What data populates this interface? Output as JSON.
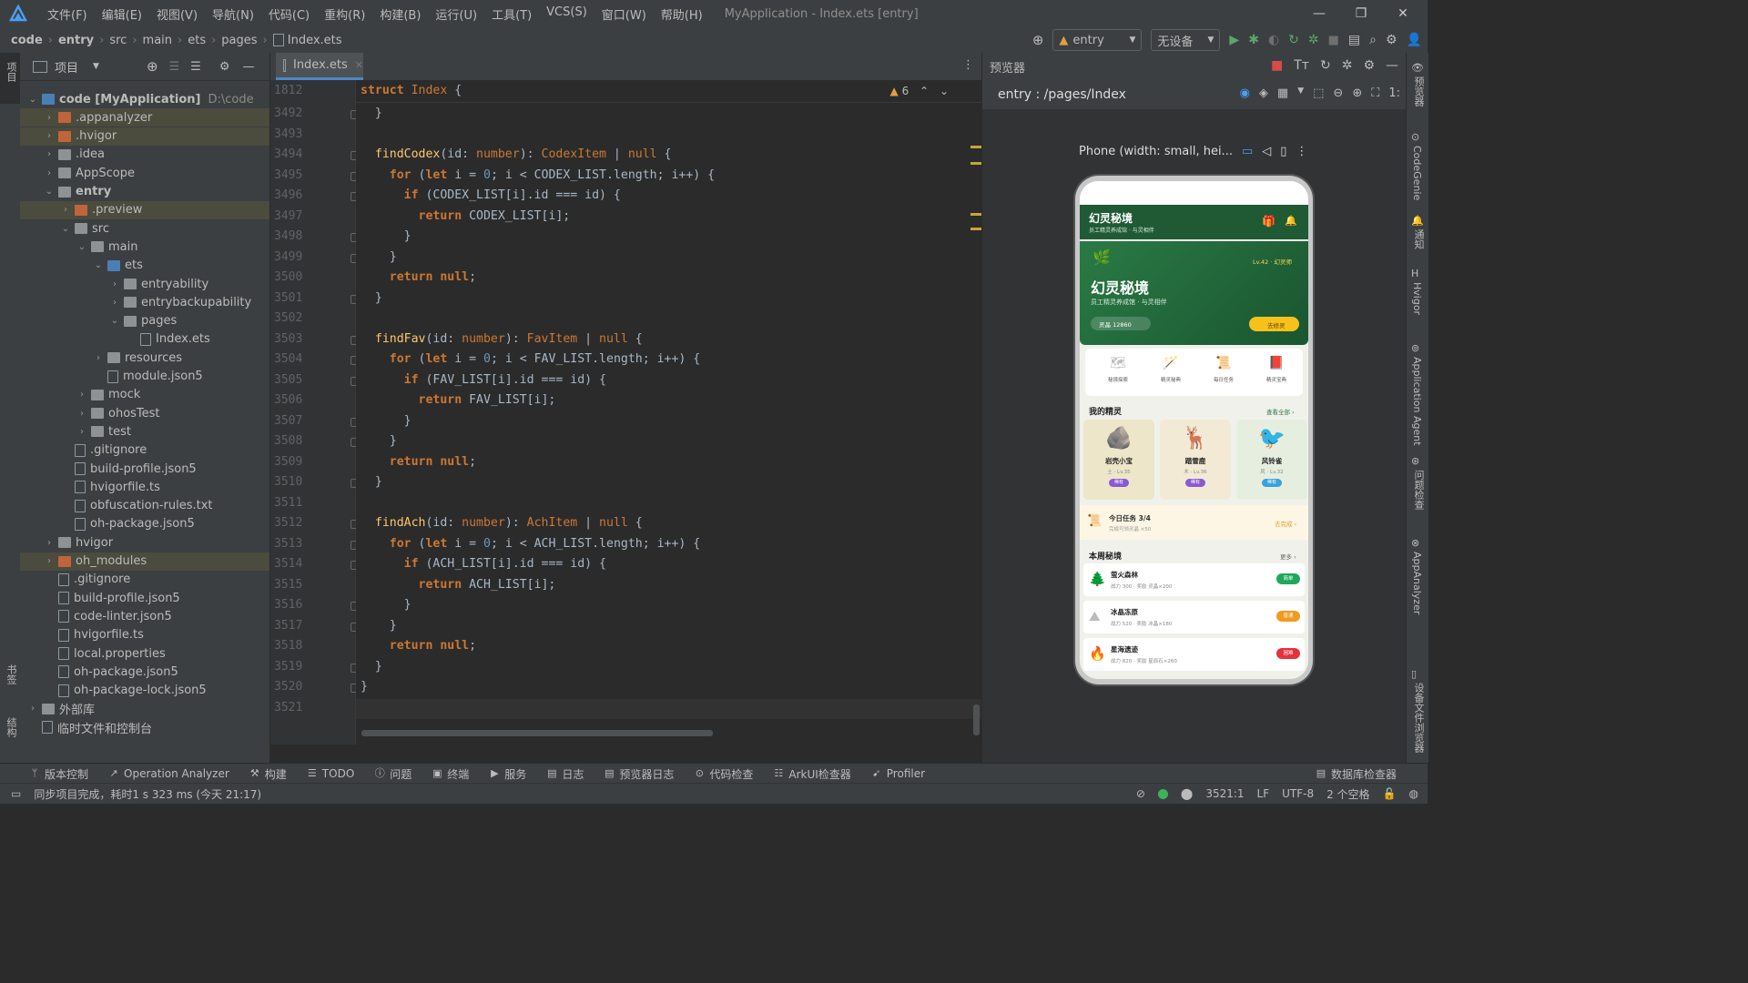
{
  "titlebar": {
    "menu": [
      "文件(F)",
      "编辑(E)",
      "视图(V)",
      "导航(N)",
      "代码(C)",
      "重构(R)",
      "构建(B)",
      "运行(U)",
      "工具(T)",
      "VCS(S)",
      "窗口(W)",
      "帮助(H)"
    ],
    "window_title": "MyApplication - Index.ets [entry]"
  },
  "breadcrumb": [
    "code",
    "entry",
    "src",
    "main",
    "ets",
    "pages",
    "Index.ets"
  ],
  "toolbar_right": {
    "module": "entry",
    "device": "无设备"
  },
  "left_strip": {
    "top_label": "项目",
    "bottom1": "书签",
    "bottom2": "结构"
  },
  "project": {
    "title": "项目",
    "items": [
      {
        "name": "code [MyApplication]",
        "extra": "D:\\code",
        "level": 0,
        "arrow": "open",
        "kind": "folder-bl",
        "sel": false,
        "bold": true
      },
      {
        "name": ".appanalyzer",
        "level": 1,
        "arrow": "closed",
        "kind": "folder-or",
        "sel": true
      },
      {
        "name": ".hvigor",
        "level": 1,
        "arrow": "closed",
        "kind": "folder-or",
        "sel": true
      },
      {
        "name": ".idea",
        "level": 1,
        "arrow": "closed",
        "kind": "folder",
        "sel": false
      },
      {
        "name": "AppScope",
        "level": 1,
        "arrow": "closed",
        "kind": "folder",
        "sel": false
      },
      {
        "name": "entry",
        "level": 1,
        "arrow": "open",
        "kind": "folder",
        "sel": false,
        "bold": true
      },
      {
        "name": ".preview",
        "level": 2,
        "arrow": "closed",
        "kind": "folder-or",
        "sel": true
      },
      {
        "name": "src",
        "level": 2,
        "arrow": "open",
        "kind": "folder",
        "sel": false
      },
      {
        "name": "main",
        "level": 3,
        "arrow": "open",
        "kind": "folder",
        "sel": false
      },
      {
        "name": "ets",
        "level": 4,
        "arrow": "open",
        "kind": "folder-bl",
        "sel": false
      },
      {
        "name": "entryability",
        "level": 5,
        "arrow": "closed",
        "kind": "folder",
        "sel": false
      },
      {
        "name": "entrybackupability",
        "level": 5,
        "arrow": "closed",
        "kind": "folder",
        "sel": false
      },
      {
        "name": "pages",
        "level": 5,
        "arrow": "open",
        "kind": "folder",
        "sel": false
      },
      {
        "name": "Index.ets",
        "level": 6,
        "arrow": "none",
        "kind": "file",
        "sel": false
      },
      {
        "name": "resources",
        "level": 4,
        "arrow": "closed",
        "kind": "folder",
        "sel": false
      },
      {
        "name": "module.json5",
        "level": 4,
        "arrow": "none",
        "kind": "file",
        "sel": false
      },
      {
        "name": "mock",
        "level": 3,
        "arrow": "closed",
        "kind": "folder",
        "sel": false
      },
      {
        "name": "ohosTest",
        "level": 3,
        "arrow": "closed",
        "kind": "folder",
        "sel": false
      },
      {
        "name": "test",
        "level": 3,
        "arrow": "closed",
        "kind": "folder",
        "sel": false
      },
      {
        "name": ".gitignore",
        "level": 2,
        "arrow": "none",
        "kind": "file",
        "sel": false
      },
      {
        "name": "build-profile.json5",
        "level": 2,
        "arrow": "none",
        "kind": "file",
        "sel": false
      },
      {
        "name": "hvigorfile.ts",
        "level": 2,
        "arrow": "none",
        "kind": "file",
        "sel": false
      },
      {
        "name": "obfuscation-rules.txt",
        "level": 2,
        "arrow": "none",
        "kind": "file",
        "sel": false
      },
      {
        "name": "oh-package.json5",
        "level": 2,
        "arrow": "none",
        "kind": "file",
        "sel": false
      },
      {
        "name": "hvigor",
        "level": 1,
        "arrow": "closed",
        "kind": "folder",
        "sel": false
      },
      {
        "name": "oh_modules",
        "level": 1,
        "arrow": "closed",
        "kind": "folder-or",
        "sel": true
      },
      {
        "name": ".gitignore",
        "level": 1,
        "arrow": "none",
        "kind": "file",
        "sel": false
      },
      {
        "name": "build-profile.json5",
        "level": 1,
        "arrow": "none",
        "kind": "file",
        "sel": false
      },
      {
        "name": "code-linter.json5",
        "level": 1,
        "arrow": "none",
        "kind": "file",
        "sel": false
      },
      {
        "name": "hvigorfile.ts",
        "level": 1,
        "arrow": "none",
        "kind": "file",
        "sel": false
      },
      {
        "name": "local.properties",
        "level": 1,
        "arrow": "none",
        "kind": "file",
        "sel": false
      },
      {
        "name": "oh-package.json5",
        "level": 1,
        "arrow": "none",
        "kind": "file",
        "sel": false
      },
      {
        "name": "oh-package-lock.json5",
        "level": 1,
        "arrow": "none",
        "kind": "file",
        "sel": false
      },
      {
        "name": "外部库",
        "level": 0,
        "arrow": "closed",
        "kind": "lib",
        "sel": false
      },
      {
        "name": "临时文件和控制台",
        "level": 0,
        "arrow": "none",
        "kind": "scratch",
        "sel": false
      }
    ]
  },
  "editor": {
    "tab": "Index.ets",
    "warning_count": "6",
    "sticky": {
      "line": "1812",
      "text": [
        [
          "kw",
          "struct "
        ],
        [
          "ty",
          "Index "
        ],
        [
          "id",
          "{"
        ]
      ]
    },
    "lines": [
      {
        "n": "3492",
        "t": [
          [
            "id",
            "  }"
          ]
        ]
      },
      {
        "n": "3493",
        "t": []
      },
      {
        "n": "3494",
        "t": [
          [
            "fn",
            "  findCodex"
          ],
          [
            "id",
            "(id: "
          ],
          [
            "ty",
            "number"
          ],
          [
            "id",
            "): "
          ],
          [
            "ty",
            "CodexItem"
          ],
          [
            "id",
            " | "
          ],
          [
            "ty",
            "null"
          ],
          [
            "id",
            " {"
          ]
        ]
      },
      {
        "n": "3495",
        "t": [
          [
            "kw",
            "    for "
          ],
          [
            "id",
            "("
          ],
          [
            "kw",
            "let "
          ],
          [
            "id",
            "i = "
          ],
          [
            "nm",
            "0"
          ],
          [
            "id",
            "; i < CODEX_LIST.length; i++) {"
          ]
        ]
      },
      {
        "n": "3496",
        "t": [
          [
            "kw",
            "      if "
          ],
          [
            "id",
            "(CODEX_LIST[i].id === id) {"
          ]
        ]
      },
      {
        "n": "3497",
        "t": [
          [
            "kw",
            "        return "
          ],
          [
            "id",
            "CODEX_LIST[i];"
          ]
        ]
      },
      {
        "n": "3498",
        "t": [
          [
            "id",
            "      }"
          ]
        ]
      },
      {
        "n": "3499",
        "t": [
          [
            "id",
            "    }"
          ]
        ]
      },
      {
        "n": "3500",
        "t": [
          [
            "kw",
            "    return null"
          ],
          [
            "id",
            ";"
          ]
        ]
      },
      {
        "n": "3501",
        "t": [
          [
            "id",
            "  }"
          ]
        ]
      },
      {
        "n": "3502",
        "t": []
      },
      {
        "n": "3503",
        "t": [
          [
            "fn",
            "  findFav"
          ],
          [
            "id",
            "(id: "
          ],
          [
            "ty",
            "number"
          ],
          [
            "id",
            "): "
          ],
          [
            "ty",
            "FavItem"
          ],
          [
            "id",
            " | "
          ],
          [
            "ty",
            "null"
          ],
          [
            "id",
            " {"
          ]
        ]
      },
      {
        "n": "3504",
        "t": [
          [
            "kw",
            "    for "
          ],
          [
            "id",
            "("
          ],
          [
            "kw",
            "let "
          ],
          [
            "id",
            "i = "
          ],
          [
            "nm",
            "0"
          ],
          [
            "id",
            "; i < FAV_LIST.length; i++) {"
          ]
        ]
      },
      {
        "n": "3505",
        "t": [
          [
            "kw",
            "      if "
          ],
          [
            "id",
            "(FAV_LIST[i].id === id) {"
          ]
        ]
      },
      {
        "n": "3506",
        "t": [
          [
            "kw",
            "        return "
          ],
          [
            "id",
            "FAV_LIST[i];"
          ]
        ]
      },
      {
        "n": "3507",
        "t": [
          [
            "id",
            "      }"
          ]
        ]
      },
      {
        "n": "3508",
        "t": [
          [
            "id",
            "    }"
          ]
        ]
      },
      {
        "n": "3509",
        "t": [
          [
            "kw",
            "    return null"
          ],
          [
            "id",
            ";"
          ]
        ]
      },
      {
        "n": "3510",
        "t": [
          [
            "id",
            "  }"
          ]
        ]
      },
      {
        "n": "3511",
        "t": []
      },
      {
        "n": "3512",
        "t": [
          [
            "fn",
            "  findAch"
          ],
          [
            "id",
            "(id: "
          ],
          [
            "ty",
            "number"
          ],
          [
            "id",
            "): "
          ],
          [
            "ty",
            "AchItem"
          ],
          [
            "id",
            " | "
          ],
          [
            "ty",
            "null"
          ],
          [
            "id",
            " {"
          ]
        ]
      },
      {
        "n": "3513",
        "t": [
          [
            "kw",
            "    for "
          ],
          [
            "id",
            "("
          ],
          [
            "kw",
            "let "
          ],
          [
            "id",
            "i = "
          ],
          [
            "nm",
            "0"
          ],
          [
            "id",
            "; i < ACH_LIST.length; i++) {"
          ]
        ]
      },
      {
        "n": "3514",
        "t": [
          [
            "kw",
            "      if "
          ],
          [
            "id",
            "(ACH_LIST[i].id === id) {"
          ]
        ]
      },
      {
        "n": "3515",
        "t": [
          [
            "kw",
            "        return "
          ],
          [
            "id",
            "ACH_LIST[i];"
          ]
        ]
      },
      {
        "n": "3516",
        "t": [
          [
            "id",
            "      }"
          ]
        ]
      },
      {
        "n": "3517",
        "t": [
          [
            "id",
            "    }"
          ]
        ]
      },
      {
        "n": "3518",
        "t": [
          [
            "kw",
            "    return null"
          ],
          [
            "id",
            ";"
          ]
        ]
      },
      {
        "n": "3519",
        "t": [
          [
            "id",
            "  }"
          ]
        ]
      },
      {
        "n": "3520",
        "t": [
          [
            "id",
            "}"
          ]
        ]
      },
      {
        "n": "3521",
        "t": []
      }
    ]
  },
  "previewer": {
    "title": "预览器",
    "route": "entry : /pages/Index",
    "device_label": "Phone (width: small, hei...",
    "app": {
      "header_title": "幻灵秘境",
      "header_sub": "员工精灵养成馆 · 与灵相伴",
      "hero_level": "Lv.42 · 幻灵师",
      "hero_title": "幻灵秘境",
      "hero_sub": "员工精灵养成馆 · 与灵相伴",
      "hero_coins": "灵晶 12860",
      "hero_button": "去修灵",
      "quick": [
        "秘境探索",
        "精灵秘典",
        "每日任务",
        "精灵宝典"
      ],
      "my_sprites_title": "我的精灵",
      "my_sprites_more": "查看全部 ›",
      "sprites": [
        {
          "name": "岩壳小宝",
          "meta": "土 · Lv.35",
          "tag": "稀有"
        },
        {
          "name": "踏雪鹿",
          "meta": "木 · Lv.36",
          "tag": "稀有"
        },
        {
          "name": "风铃雀",
          "meta": "风 · Lv.32",
          "tag": "稀有"
        }
      ],
      "task_title": "今日任务 3/4",
      "task_sub": "完成可领灵晶 ×50",
      "task_action": "去完成 ›",
      "weekly_title": "本周秘境",
      "weekly_more": "更多 ›",
      "realms": [
        {
          "name": "萤火森林",
          "meta": "战力 300 · 奖励 灵晶×200",
          "badge": "简单",
          "color": "#1fa85a"
        },
        {
          "name": "冰晶冻原",
          "meta": "战力 520 · 奖励 冰晶×180",
          "badge": "普通",
          "color": "#f29a1f"
        },
        {
          "name": "星海遗迹",
          "meta": "战力 820 · 奖励 星辰石×260",
          "badge": "困难",
          "color": "#e5313a"
        }
      ]
    }
  },
  "right_strip": [
    "预览器",
    "CodeGenie",
    "通知",
    "Hvigor",
    "Application Agent",
    "问题检查",
    "AppAnalyzer",
    "设备文件浏览器"
  ],
  "bottom_toolbar": [
    {
      "icon": "branch-icon",
      "label": "版本控制"
    },
    {
      "icon": "analyzer-icon",
      "label": "Operation Analyzer"
    },
    {
      "icon": "hammer-icon",
      "label": "构建"
    },
    {
      "icon": "list-icon",
      "label": "TODO"
    },
    {
      "icon": "info-icon",
      "label": "问题"
    },
    {
      "icon": "terminal-icon",
      "label": "终端"
    },
    {
      "icon": "play-icon",
      "label": "服务"
    },
    {
      "icon": "log-icon",
      "label": "日志"
    },
    {
      "icon": "log-icon",
      "label": "预览器日志"
    },
    {
      "icon": "inspect-icon",
      "label": "代码检查"
    },
    {
      "icon": "tree-icon",
      "label": "ArkUI检查器"
    },
    {
      "icon": "profiler-icon",
      "label": "Profiler"
    }
  ],
  "bottom_right": "数据库检查器",
  "status": {
    "message": "同步项目完成，耗时1 s 323 ms (今天 21:17)",
    "position": "3521:1",
    "line_sep": "LF",
    "encoding": "UTF-8",
    "indent": "2 个空格"
  }
}
